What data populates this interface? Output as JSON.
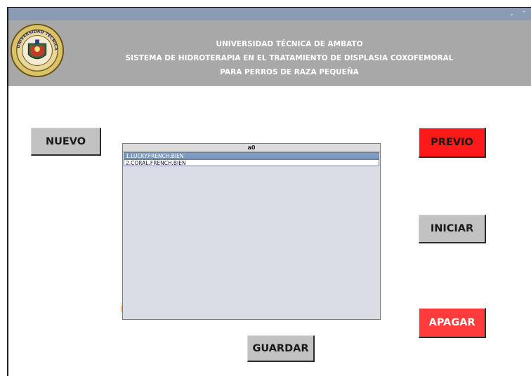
{
  "window": {
    "controls": [
      "⌄",
      "⌃"
    ]
  },
  "header": {
    "line1": "UNIVERSIDAD TÉCNICA DE AMBATO",
    "line2": "SISTEMA DE HIDROTERAPIA EN EL TRATAMIENTO DE DISPLASIA COXOFEMORAL",
    "line3": "PARA PERROS DE RAZA PEQUEÑA",
    "logo_text": "UNIVERSIDAD TÉCNICA DE AMBATO"
  },
  "buttons": {
    "nuevo": "NUEVO",
    "previo": "PREVIO",
    "iniciar": "INICIAR",
    "apagar": "APAGAR",
    "guardar": "GUARDAR"
  },
  "list": {
    "header": "a0",
    "items": [
      {
        "label": "1.LUCKY.FRENCH.BIEN",
        "selected": true
      },
      {
        "label": "2.CORAL.FRENCH.BIEN",
        "selected": false
      }
    ]
  },
  "colors": {
    "titlebar": "#8a9bb3",
    "header_bg": "#a8a8a8",
    "previo_bg": "#ff1a1a",
    "apagar_bg": "#ff3b3b",
    "button_gray": "#c2c2c2",
    "list_bg": "#dadde4",
    "selected_row": "#7d9cc4"
  }
}
